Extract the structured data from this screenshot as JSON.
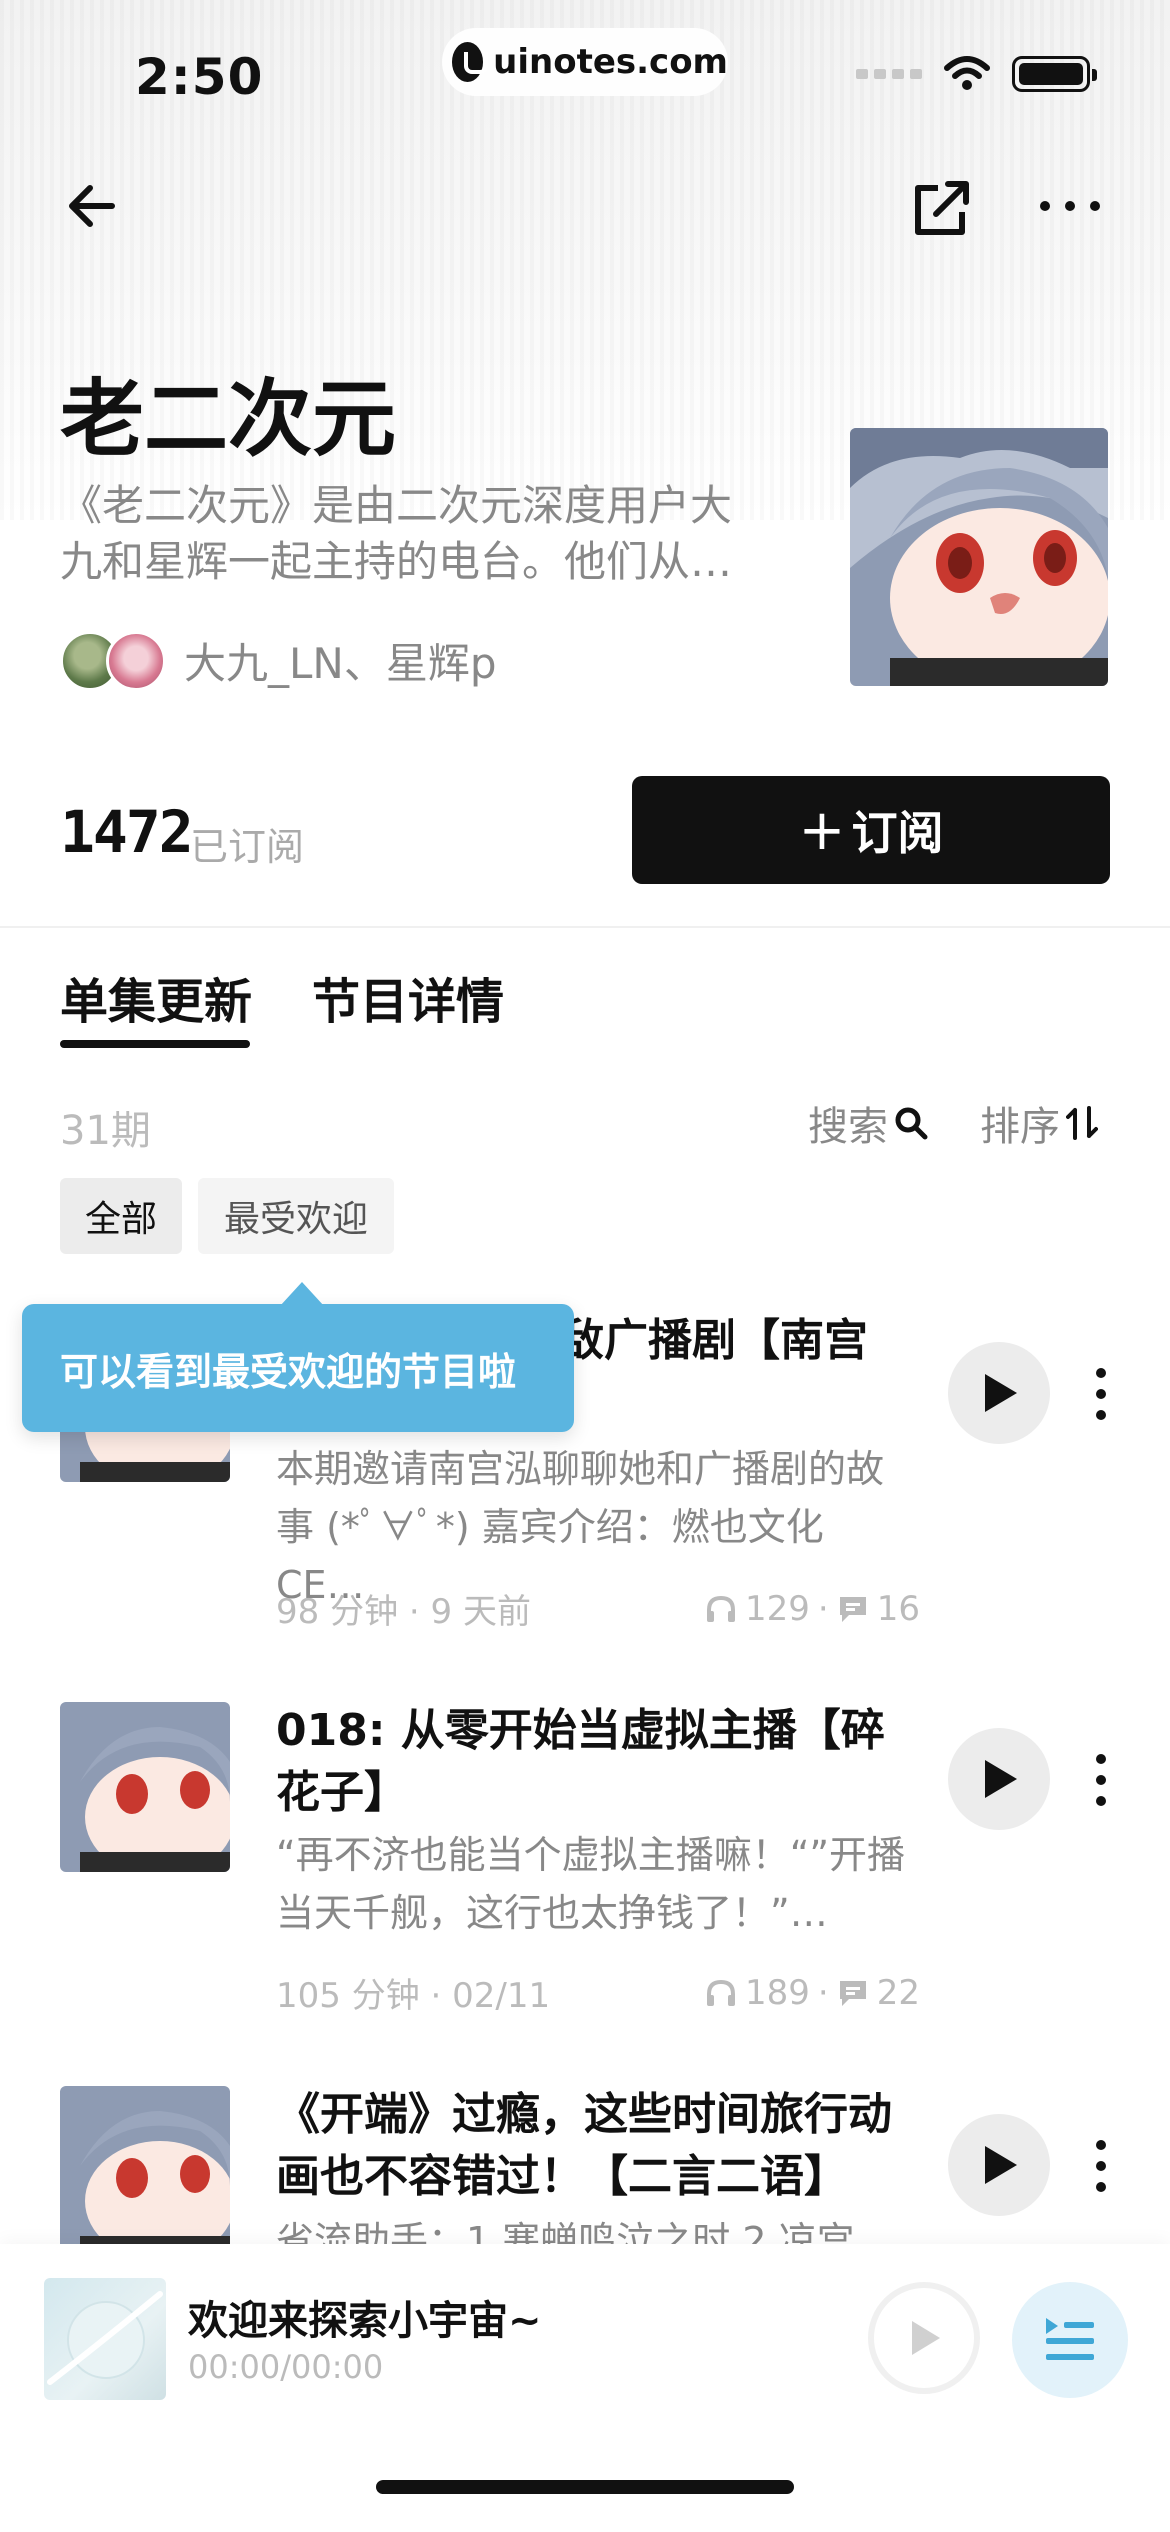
{
  "status_bar": {
    "time": "2:50",
    "site": "uinotes.com"
  },
  "show": {
    "title": "老二次元",
    "description": "《老二次元》是由二次元深度用户大九和星辉一起主持的电台。他们从…",
    "hosts": "大九_LN、星辉p",
    "subscribers": "1472",
    "subscribers_label": "已订阅",
    "subscribe_button": "订阅"
  },
  "tabs": [
    {
      "label": "单集更新",
      "active": true
    },
    {
      "label": "节目详情",
      "active": false
    }
  ],
  "list_controls": {
    "episode_count": "31期",
    "search": "搜索",
    "sort": "排序"
  },
  "filters": [
    {
      "label": "全部"
    },
    {
      "label": "最受欢迎"
    }
  ],
  "tooltip": "可以看到最受欢迎的节目啦",
  "episodes": [
    {
      "title": "敌广播剧【南宫",
      "description": "本期邀请南宫泓聊聊她和广播剧的故事 (*ﾟ∀ﾟ*) 嘉宾介绍：燃也文化 CE…",
      "duration": "98 分钟",
      "date": "9 天前",
      "plays": "129",
      "comments": "16"
    },
    {
      "title": "018: 从零开始当虚拟主播【碎花子】",
      "description": "“再不济也能当个虚拟主播嘛！“”开播当天千舰，这行也太挣钱了！”…",
      "duration": "105 分钟",
      "date": "02/11",
      "plays": "189",
      "comments": "22"
    },
    {
      "title": "《开端》过瘾，这些时间旅行动画也不容错过！【二言二语】",
      "description": "省流助手：1.寒蝉鸣泣之时 2.凉宫",
      "duration": "",
      "date": "",
      "plays": "",
      "comments": ""
    }
  ],
  "mini_player": {
    "title": "欢迎来探索小宇宙~",
    "time": "00:00/00:00"
  },
  "colors": {
    "accent": "#5bb5e0",
    "primary": "#111111",
    "muted": "#888888"
  }
}
